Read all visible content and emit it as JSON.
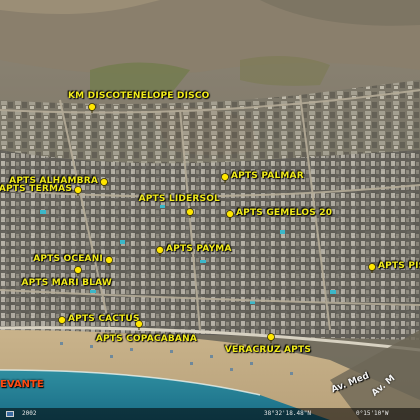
{
  "map": {
    "pins": [
      {
        "id": "km",
        "label": "KM DISCOTENELOPE DISCO",
        "side": "top"
      },
      {
        "id": "alhambra",
        "label": "APTS ALHAMBRA",
        "side": "left"
      },
      {
        "id": "termas",
        "label": "APTS TERMAS",
        "side": "left"
      },
      {
        "id": "palmar",
        "label": "APTS PALMAR",
        "side": "right"
      },
      {
        "id": "lidersol",
        "label": "APTS LIDERSOL",
        "side": "left"
      },
      {
        "id": "gemelos",
        "label": "APTS GEMELOS 20",
        "side": "right"
      },
      {
        "id": "payma",
        "label": "APTS PAYMA",
        "side": "right"
      },
      {
        "id": "oceani",
        "label": "APTS OCEANI",
        "side": "left"
      },
      {
        "id": "pis",
        "label": "APTS PIS",
        "side": "right"
      },
      {
        "id": "marblaw",
        "label": "APTS MARI BLAW",
        "side": "left"
      },
      {
        "id": "cactus",
        "label": "APTS CACTUS",
        "side": "right"
      },
      {
        "id": "copacabana",
        "label": "APTS COPACABANA",
        "side": "left"
      },
      {
        "id": "veracruz",
        "label": "VERACRUZ APTS",
        "side": "left"
      }
    ],
    "beach_label": "EVANTE",
    "street_label": "Av. Med",
    "street_label_2": "Av. M",
    "label_color": "#f2ec1c",
    "pin_color": "#ffe600"
  },
  "statusbar": {
    "year": "2002",
    "coords": "38°32'18.48\"N",
    "cam": "0°15'10\"W"
  }
}
